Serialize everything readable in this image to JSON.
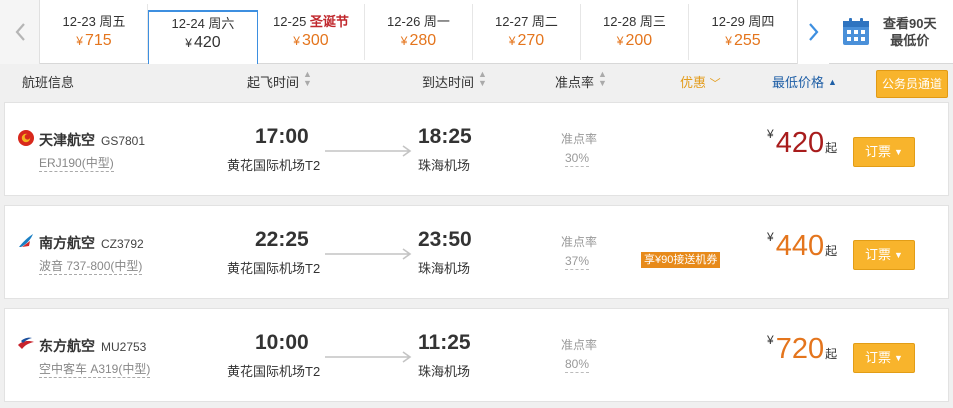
{
  "date_strip": {
    "tabs": [
      {
        "date": "12-23",
        "label": "周五",
        "holiday": "",
        "price": "715",
        "active": false
      },
      {
        "date": "12-24",
        "label": "周六",
        "holiday": "",
        "price": "420",
        "active": true
      },
      {
        "date": "12-25",
        "label": "",
        "holiday": "圣诞节",
        "price": "300",
        "active": false
      },
      {
        "date": "12-26",
        "label": "周一",
        "holiday": "",
        "price": "280",
        "active": false
      },
      {
        "date": "12-27",
        "label": "周二",
        "holiday": "",
        "price": "270",
        "active": false
      },
      {
        "date": "12-28",
        "label": "周三",
        "holiday": "",
        "price": "200",
        "active": false
      },
      {
        "date": "12-29",
        "label": "周四",
        "holiday": "",
        "price": "255",
        "active": false
      }
    ],
    "currency": "¥",
    "calendar_line1": "查看90天",
    "calendar_line2": "最低价",
    "prev_icon": "chevron-left-icon",
    "next_icon": "chevron-right-icon",
    "calendar_icon": "calendar-icon"
  },
  "header": {
    "flight_info": "航班信息",
    "departure_time": "起飞时间",
    "arrival_time": "到达时间",
    "on_time_rate": "准点率",
    "discount": "优惠",
    "lowest_price": "最低价格",
    "gov_channel": "公务员通道"
  },
  "flights": [
    {
      "airline": "天津航空",
      "flight_no": "GS7801",
      "aircraft": "ERJ190(中型)",
      "dep_time": "17:00",
      "dep_airport": "黄花国际机场T2",
      "arr_time": "18:25",
      "arr_airport": "珠海机场",
      "on_time_label": "准点率",
      "on_time_rate": "30%",
      "promo": "",
      "currency": "¥",
      "price": "420",
      "price_suffix": "起",
      "price_color": "#a81c1c",
      "book_label": "订票",
      "logo_icon": "tianjin-airlines-logo-icon"
    },
    {
      "airline": "南方航空",
      "flight_no": "CZ3792",
      "aircraft": "波音 737-800(中型)",
      "dep_time": "22:25",
      "dep_airport": "黄花国际机场T2",
      "arr_time": "23:50",
      "arr_airport": "珠海机场",
      "on_time_label": "准点率",
      "on_time_rate": "37%",
      "promo": "享¥90接送机券",
      "currency": "¥",
      "price": "440",
      "price_suffix": "起",
      "price_color": "#e4751d",
      "book_label": "订票",
      "logo_icon": "china-southern-logo-icon"
    },
    {
      "airline": "东方航空",
      "flight_no": "MU2753",
      "aircraft": "空中客车 A319(中型)",
      "dep_time": "10:00",
      "dep_airport": "黄花国际机场T2",
      "arr_time": "11:25",
      "arr_airport": "珠海机场",
      "on_time_label": "准点率",
      "on_time_rate": "80%",
      "promo": "",
      "currency": "¥",
      "price": "720",
      "price_suffix": "起",
      "price_color": "#e4751d",
      "book_label": "订票",
      "logo_icon": "china-eastern-logo-icon"
    }
  ],
  "colors": {
    "accent_orange": "#f8b42c",
    "price_orange": "#e4751d",
    "price_red": "#a81c1c",
    "active_tab_border": "#3d8fe0",
    "header_price_blue": "#1f5fa6"
  }
}
